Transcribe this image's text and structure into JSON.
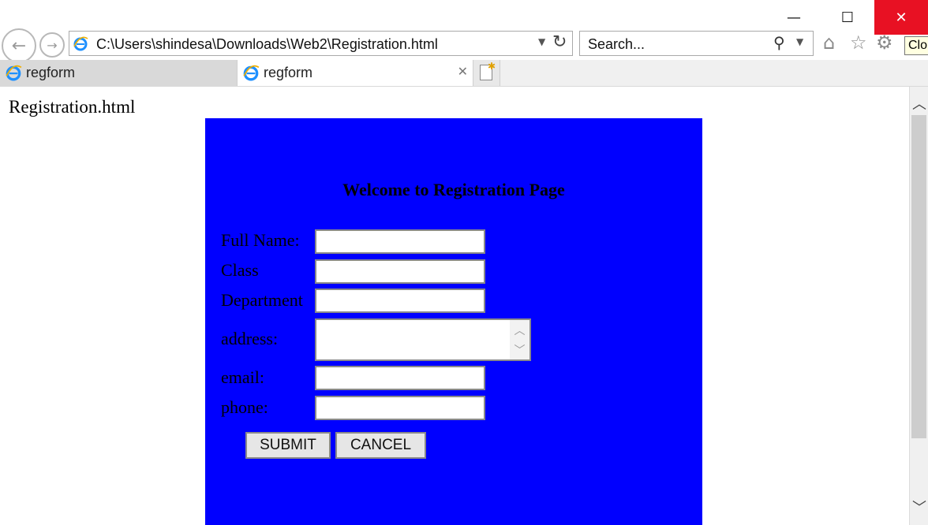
{
  "window": {
    "minimize_glyph": "—",
    "maximize_glyph": "☐",
    "close_glyph": "✕"
  },
  "toolbar": {
    "address": "C:\\Users\\shindesa\\Downloads\\Web2\\Registration.html",
    "search_placeholder": "Search...",
    "tooltip": "Clo"
  },
  "tabs": [
    {
      "label": "regform",
      "active": false
    },
    {
      "label": "regform",
      "active": true
    }
  ],
  "page": {
    "heading": "Registration.html",
    "form": {
      "title": "Welcome to Registration Page",
      "fields": [
        {
          "label": "Full Name:",
          "value": ""
        },
        {
          "label": "Class",
          "value": ""
        },
        {
          "label": "Department",
          "value": ""
        },
        {
          "label": "address:",
          "value": ""
        },
        {
          "label": "email:",
          "value": ""
        },
        {
          "label": "phone:",
          "value": ""
        }
      ],
      "submit_label": "SUBMIT",
      "cancel_label": "CANCEL"
    }
  },
  "colors": {
    "form_background": "#0000ff",
    "close_button": "#e81123"
  }
}
